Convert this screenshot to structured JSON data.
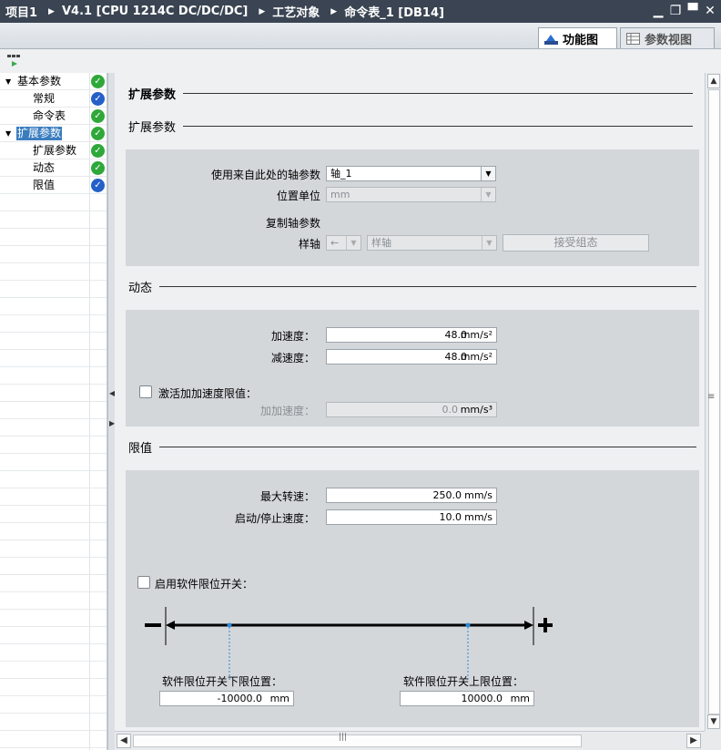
{
  "titlebar": {
    "crumbs": [
      "项目1",
      "V4.1 [CPU 1214C DC/DC/DC]",
      "工艺对象",
      "命令表_1 [DB14]"
    ],
    "sep": "▶",
    "min": "▁",
    "restore": "❐",
    "max": "▀",
    "close": "✕"
  },
  "view_tabs": {
    "functional": "功能图",
    "parameter": "参数视图"
  },
  "nav": {
    "items": [
      {
        "label": "基本参数",
        "toggle": "▼",
        "status": "ok"
      },
      {
        "label": "常规",
        "toggle": "",
        "status": "info"
      },
      {
        "label": "命令表",
        "toggle": "",
        "status": "ok"
      },
      {
        "label": "扩展参数",
        "toggle": "▼",
        "status": "ok",
        "selected": true
      },
      {
        "label": "扩展参数",
        "toggle": "",
        "status": "ok"
      },
      {
        "label": "动态",
        "toggle": "",
        "status": "ok"
      },
      {
        "label": "限值",
        "toggle": "",
        "status": "info"
      }
    ]
  },
  "main": {
    "page_title": "扩展参数",
    "sections": {
      "ext": "扩展参数",
      "dyn": "动态",
      "limits": "限值"
    },
    "ext": {
      "axis_param_label": "使用来自此处的轴参数",
      "axis_param_value": "轴_1",
      "pos_unit_label": "位置单位",
      "pos_unit_value": "mm",
      "copy_axis_label": "复制轴参数",
      "sample_axis_label": "样轴",
      "sample_arrow_value": "←",
      "sample_axis_value": "样轴",
      "accept_button": "接受组态"
    },
    "dyn": {
      "accel_label": "加速度：",
      "accel_value": "48.0",
      "accel_unit": "mm/s²",
      "decel_label": "减速度：",
      "decel_value": "48.0",
      "decel_unit": "mm/s²",
      "jerk_check_label": "激活加加速度限值：",
      "jerk_label": "加加速度：",
      "jerk_value": "0.0",
      "jerk_unit": "mm/s³"
    },
    "limits": {
      "max_speed_label": "最大转速：",
      "max_speed_value": "250.0",
      "max_speed_unit": "mm/s",
      "startstop_label": "启动/停止速度：",
      "startstop_value": "10.0",
      "startstop_unit": "mm/s",
      "sw_limit_check_label": "启用软件限位开关：",
      "minus": "−",
      "plus": "+",
      "lower_label": "软件限位开关下限位置：",
      "lower_value": "-10000.0",
      "lower_unit": "mm",
      "upper_label": "软件限位开关上限位置：",
      "upper_value": "10000.0",
      "upper_unit": "mm"
    }
  },
  "colors": {
    "title_bg": "#3a4452",
    "status_ok": "#2fa83a",
    "status_info": "#2560c8",
    "selection": "#3a7dbf",
    "panel_bg": "#d4d7da"
  }
}
